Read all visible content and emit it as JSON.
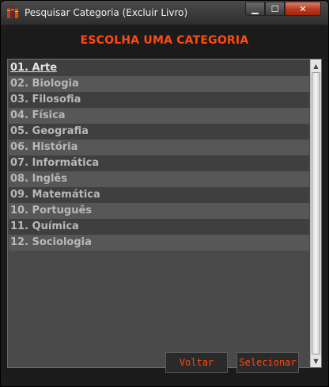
{
  "window": {
    "title": "Pesquisar Categoria (Excluir Livro)",
    "controls": {
      "minimize": "▁",
      "maximize": "☐",
      "close": "✕"
    }
  },
  "header": {
    "title": "ESCOLHA UMA CATEGORIA"
  },
  "list": {
    "selected_index": 0,
    "items": [
      {
        "label": "01. Arte"
      },
      {
        "label": "02. Biologia"
      },
      {
        "label": "03. Filosofia"
      },
      {
        "label": "04. Física"
      },
      {
        "label": "05. Geografia"
      },
      {
        "label": "06. História"
      },
      {
        "label": "07. Informática"
      },
      {
        "label": "08. Inglês"
      },
      {
        "label": "09. Matemática"
      },
      {
        "label": "10. Português"
      },
      {
        "label": "11. Química"
      },
      {
        "label": "12. Sociologia"
      }
    ]
  },
  "scrollbar": {
    "up": "▲",
    "down": "▼"
  },
  "buttons": {
    "voltar": "Voltar",
    "selecionar": "Selecionar"
  },
  "colors": {
    "accent": "#ff4a10",
    "row_dark": "#3f3f3f",
    "row_light": "#575757"
  }
}
